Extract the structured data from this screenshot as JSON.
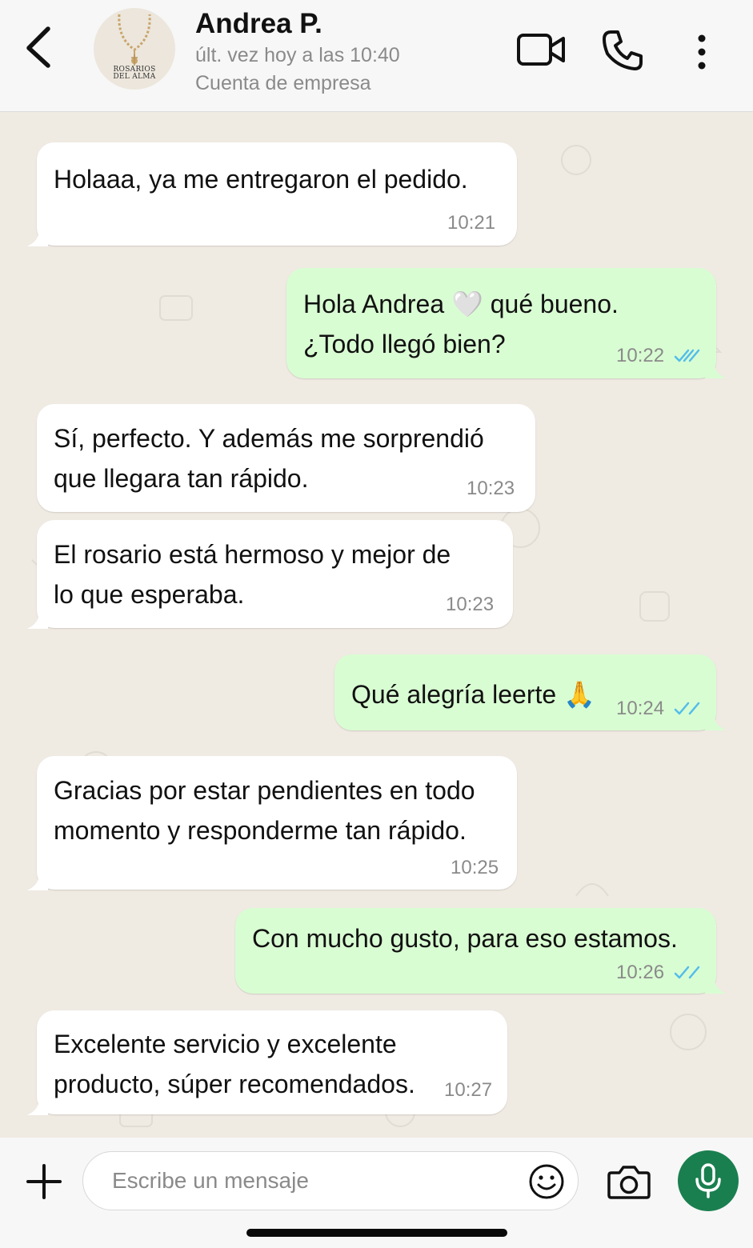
{
  "header": {
    "name": "Andrea P.",
    "status": "últ. vez hoy a las 10:40",
    "type": "Cuenta de empresa",
    "avatar_text_1": "ROSARIOS",
    "avatar_text_2": "DEL ALMA"
  },
  "messages": [
    {
      "direction": "in",
      "lines": [
        "Holaaa, ya me entregaron el pedido."
      ],
      "time": "10:21"
    },
    {
      "direction": "out",
      "lines": [
        "Hola Andrea 🤍 qué bueno.",
        "¿Todo llegó bien?"
      ],
      "time": "10:22",
      "read": true
    },
    {
      "direction": "in",
      "lines": [
        "Sí, perfecto. Y además me sorprendió",
        "que llegara tan rápido."
      ],
      "time": "10:23"
    },
    {
      "direction": "in",
      "lines": [
        "El rosario está hermoso y mejor de",
        "lo que esperaba."
      ],
      "time": "10:23"
    },
    {
      "direction": "out",
      "lines": [
        "Qué alegría leerte 🙏"
      ],
      "time": "10:24",
      "read": true
    },
    {
      "direction": "in",
      "lines": [
        "Gracias por estar pendientes en todo",
        "momento y responderme tan rápido."
      ],
      "time": "10:25"
    },
    {
      "direction": "out",
      "lines": [
        "Con mucho gusto, para eso estamos."
      ],
      "time": "10:26",
      "read": true
    },
    {
      "direction": "in",
      "lines": [
        "Excelente servicio y excelente",
        "producto, súper recomendados."
      ],
      "time": "10:27"
    }
  ],
  "composer": {
    "placeholder": "Escribe un mensaje",
    "value": ""
  },
  "colors": {
    "incoming_bubble": "#ffffff",
    "outgoing_bubble": "#d9fdd3",
    "chat_background": "#efeae2",
    "read_ticks": "#53bdeb",
    "mic_button": "#1a7f4f"
  },
  "icons": {
    "back": "chevron-left-icon",
    "video": "video-camera-icon",
    "call": "phone-icon",
    "menu": "more-vertical-icon",
    "attach": "plus-icon",
    "emoji": "smiley-icon",
    "camera": "camera-icon",
    "mic": "microphone-icon",
    "read": "double-check-icon"
  }
}
